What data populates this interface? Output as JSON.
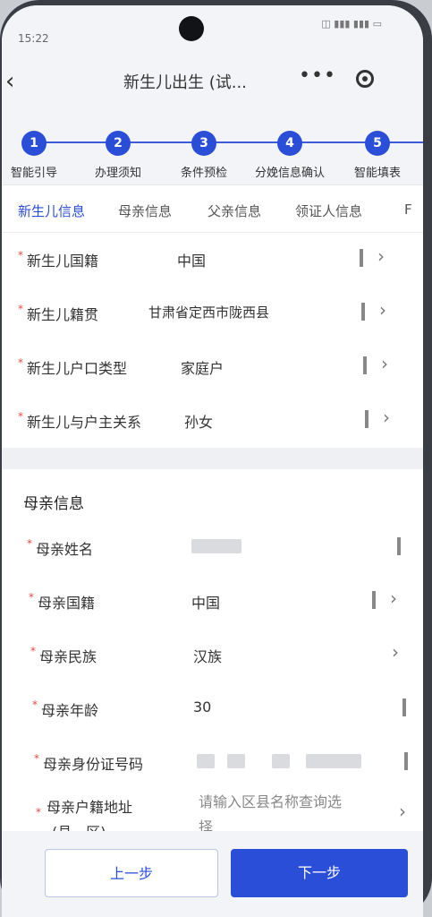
{
  "status": {
    "time": "15:22",
    "icons": "◫ ▮▮▮ ▮▮▮ ▭"
  },
  "header": {
    "back": "‹",
    "title": "新生儿出生 (试...",
    "more": "•••"
  },
  "steps": [
    {
      "num": "1",
      "label": "智能引导"
    },
    {
      "num": "2",
      "label": "办理须知"
    },
    {
      "num": "3",
      "label": "条件预检"
    },
    {
      "num": "4",
      "label": "分娩信息确认"
    },
    {
      "num": "5",
      "label": "智能填表"
    }
  ],
  "tabs": [
    "新生儿信息",
    "母亲信息",
    "父亲信息",
    "领证人信息",
    "F"
  ],
  "newborn": [
    {
      "label": "新生儿国籍",
      "value": "中国"
    },
    {
      "label": "新生儿籍贯",
      "value": "甘肃省定西市陇西县"
    },
    {
      "label": "新生儿户口类型",
      "value": "家庭户"
    },
    {
      "label": "新生儿与户主关系",
      "value": "孙女"
    }
  ],
  "mother_section_title": "母亲信息",
  "mother": {
    "name_label": "母亲姓名",
    "nationality_label": "母亲国籍",
    "nationality": "中国",
    "ethnicity_label": "母亲民族",
    "ethnicity": "汉族",
    "age_label": "母亲年龄",
    "age": "30",
    "id_label": "母亲身份证号码",
    "address_label_1": "母亲户籍地址",
    "address_label_2": "(县、区)",
    "address_placeholder_1": "请输入区县名称查询选",
    "address_placeholder_2": "择"
  },
  "footer": {
    "prev": "上一步",
    "next": "下一步"
  }
}
